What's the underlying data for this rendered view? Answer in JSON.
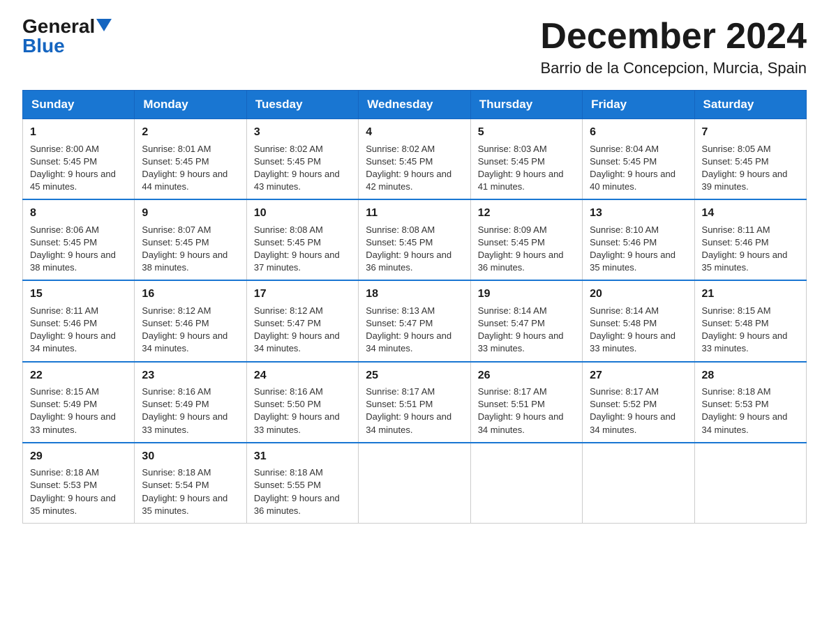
{
  "logo": {
    "general": "General",
    "triangle": "▶",
    "blue": "Blue"
  },
  "title": "December 2024",
  "subtitle": "Barrio de la Concepcion, Murcia, Spain",
  "days_of_week": [
    "Sunday",
    "Monday",
    "Tuesday",
    "Wednesday",
    "Thursday",
    "Friday",
    "Saturday"
  ],
  "weeks": [
    [
      {
        "day": "1",
        "sunrise": "8:00 AM",
        "sunset": "5:45 PM",
        "daylight": "9 hours and 45 minutes."
      },
      {
        "day": "2",
        "sunrise": "8:01 AM",
        "sunset": "5:45 PM",
        "daylight": "9 hours and 44 minutes."
      },
      {
        "day": "3",
        "sunrise": "8:02 AM",
        "sunset": "5:45 PM",
        "daylight": "9 hours and 43 minutes."
      },
      {
        "day": "4",
        "sunrise": "8:02 AM",
        "sunset": "5:45 PM",
        "daylight": "9 hours and 42 minutes."
      },
      {
        "day": "5",
        "sunrise": "8:03 AM",
        "sunset": "5:45 PM",
        "daylight": "9 hours and 41 minutes."
      },
      {
        "day": "6",
        "sunrise": "8:04 AM",
        "sunset": "5:45 PM",
        "daylight": "9 hours and 40 minutes."
      },
      {
        "day": "7",
        "sunrise": "8:05 AM",
        "sunset": "5:45 PM",
        "daylight": "9 hours and 39 minutes."
      }
    ],
    [
      {
        "day": "8",
        "sunrise": "8:06 AM",
        "sunset": "5:45 PM",
        "daylight": "9 hours and 38 minutes."
      },
      {
        "day": "9",
        "sunrise": "8:07 AM",
        "sunset": "5:45 PM",
        "daylight": "9 hours and 38 minutes."
      },
      {
        "day": "10",
        "sunrise": "8:08 AM",
        "sunset": "5:45 PM",
        "daylight": "9 hours and 37 minutes."
      },
      {
        "day": "11",
        "sunrise": "8:08 AM",
        "sunset": "5:45 PM",
        "daylight": "9 hours and 36 minutes."
      },
      {
        "day": "12",
        "sunrise": "8:09 AM",
        "sunset": "5:45 PM",
        "daylight": "9 hours and 36 minutes."
      },
      {
        "day": "13",
        "sunrise": "8:10 AM",
        "sunset": "5:46 PM",
        "daylight": "9 hours and 35 minutes."
      },
      {
        "day": "14",
        "sunrise": "8:11 AM",
        "sunset": "5:46 PM",
        "daylight": "9 hours and 35 minutes."
      }
    ],
    [
      {
        "day": "15",
        "sunrise": "8:11 AM",
        "sunset": "5:46 PM",
        "daylight": "9 hours and 34 minutes."
      },
      {
        "day": "16",
        "sunrise": "8:12 AM",
        "sunset": "5:46 PM",
        "daylight": "9 hours and 34 minutes."
      },
      {
        "day": "17",
        "sunrise": "8:12 AM",
        "sunset": "5:47 PM",
        "daylight": "9 hours and 34 minutes."
      },
      {
        "day": "18",
        "sunrise": "8:13 AM",
        "sunset": "5:47 PM",
        "daylight": "9 hours and 34 minutes."
      },
      {
        "day": "19",
        "sunrise": "8:14 AM",
        "sunset": "5:47 PM",
        "daylight": "9 hours and 33 minutes."
      },
      {
        "day": "20",
        "sunrise": "8:14 AM",
        "sunset": "5:48 PM",
        "daylight": "9 hours and 33 minutes."
      },
      {
        "day": "21",
        "sunrise": "8:15 AM",
        "sunset": "5:48 PM",
        "daylight": "9 hours and 33 minutes."
      }
    ],
    [
      {
        "day": "22",
        "sunrise": "8:15 AM",
        "sunset": "5:49 PM",
        "daylight": "9 hours and 33 minutes."
      },
      {
        "day": "23",
        "sunrise": "8:16 AM",
        "sunset": "5:49 PM",
        "daylight": "9 hours and 33 minutes."
      },
      {
        "day": "24",
        "sunrise": "8:16 AM",
        "sunset": "5:50 PM",
        "daylight": "9 hours and 33 minutes."
      },
      {
        "day": "25",
        "sunrise": "8:17 AM",
        "sunset": "5:51 PM",
        "daylight": "9 hours and 34 minutes."
      },
      {
        "day": "26",
        "sunrise": "8:17 AM",
        "sunset": "5:51 PM",
        "daylight": "9 hours and 34 minutes."
      },
      {
        "day": "27",
        "sunrise": "8:17 AM",
        "sunset": "5:52 PM",
        "daylight": "9 hours and 34 minutes."
      },
      {
        "day": "28",
        "sunrise": "8:18 AM",
        "sunset": "5:53 PM",
        "daylight": "9 hours and 34 minutes."
      }
    ],
    [
      {
        "day": "29",
        "sunrise": "8:18 AM",
        "sunset": "5:53 PM",
        "daylight": "9 hours and 35 minutes."
      },
      {
        "day": "30",
        "sunrise": "8:18 AM",
        "sunset": "5:54 PM",
        "daylight": "9 hours and 35 minutes."
      },
      {
        "day": "31",
        "sunrise": "8:18 AM",
        "sunset": "5:55 PM",
        "daylight": "9 hours and 36 minutes."
      },
      null,
      null,
      null,
      null
    ]
  ]
}
